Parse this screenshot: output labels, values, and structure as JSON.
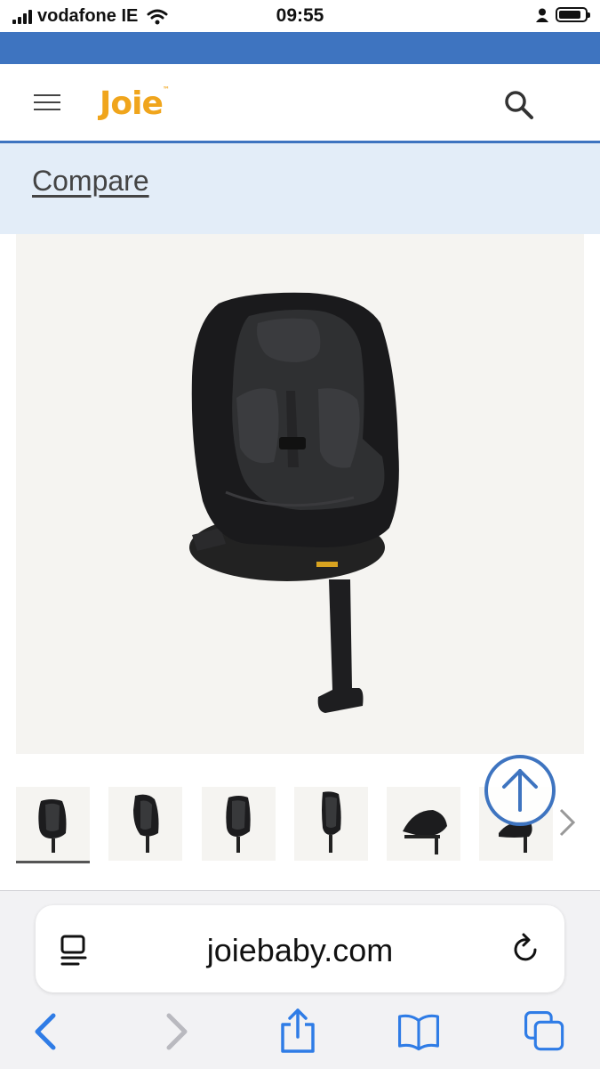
{
  "status_bar": {
    "carrier": "vodafone IE",
    "time": "09:55",
    "battery_level": 0.85
  },
  "header": {
    "logo_text": "Joie",
    "logo_tm": "™",
    "menu_icon": "hamburger-menu-icon",
    "search_icon": "search-icon",
    "brand_color": "#f0a51c",
    "accent_color": "#3e74c0"
  },
  "compare": {
    "label": "Compare",
    "background": "#e3edf8"
  },
  "product": {
    "main_image": "car-seat-image",
    "thumbnails": [
      {
        "name": "thumbnail-1",
        "active": true
      },
      {
        "name": "thumbnail-2",
        "active": false
      },
      {
        "name": "thumbnail-3",
        "active": false
      },
      {
        "name": "thumbnail-4",
        "active": false
      },
      {
        "name": "thumbnail-5",
        "active": false
      },
      {
        "name": "thumbnail-6",
        "active": false
      }
    ],
    "next_icon": "chevron-right-icon",
    "scroll_top_icon": "arrow-up-circle-icon"
  },
  "browser": {
    "url": "joiebaby.com",
    "reader_icon": "reader-icon",
    "reload_icon": "reload-icon",
    "toolbar": [
      "back-icon",
      "forward-icon",
      "share-icon",
      "bookmarks-icon",
      "tabs-icon"
    ]
  }
}
